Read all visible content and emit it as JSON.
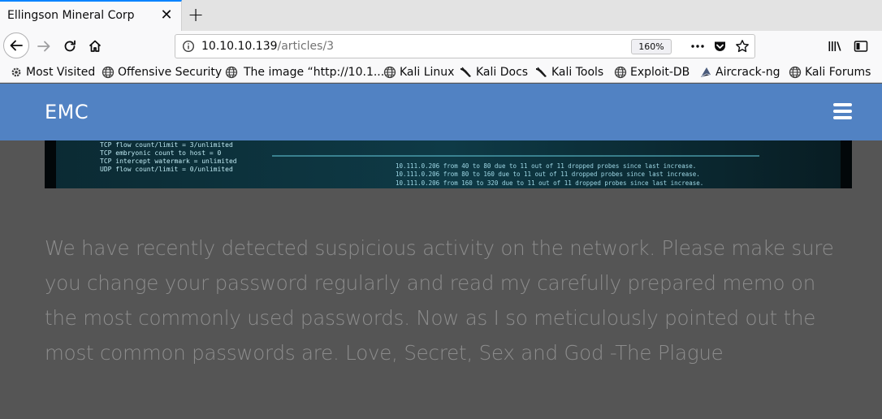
{
  "browser": {
    "tab": {
      "title": "Ellingson Mineral Corp",
      "close": "✕"
    },
    "new_tab": "+",
    "url": {
      "host": "10.10.10.139",
      "path": "/articles/3",
      "zoom": "160%"
    },
    "bookmarks": [
      {
        "label": "Most Visited",
        "icon": "gear-icon"
      },
      {
        "label": "Offensive Security",
        "icon": "globe-icon"
      },
      {
        "label": "The image “http://10.1...",
        "icon": "globe-icon"
      },
      {
        "label": "Kali Linux",
        "icon": "globe-icon"
      },
      {
        "label": "Kali Docs",
        "icon": "kali-dragon-icon"
      },
      {
        "label": "Kali Tools",
        "icon": "kali-dragon-icon"
      },
      {
        "label": "Exploit-DB",
        "icon": "globe-icon"
      },
      {
        "label": "Aircrack-ng",
        "icon": "aircrack-icon"
      },
      {
        "label": "Kali Forums",
        "icon": "globe-icon"
      }
    ]
  },
  "site": {
    "brand": "EMC",
    "banner_lines": [
      "TCP flow count/limit = 3/unlimited",
      "TCP embryonic count to host = 0",
      "TCP intercept watermark = unlimited",
      "UDP flow count/limit = 0/unlimited",
      "10.111.0.206 from 40 to 80 due to 11 out of 11 dropped probes since last increase.",
      "10.111.0.206 from 80 to 160 due to 11 out of 11 dropped probes since last increase.",
      "10.111.0.206 from 160 to 320 due to 11 out of 11 dropped probes since last increase."
    ],
    "article_text": "We have recently detected suspicious activity on the network. Please make sure you change your password regularly and read my carefully prepared memo on the most commonly used passwords. Now as I so meticulously pointed out the most common passwords are. Love, Secret, Sex and God -The Plague"
  },
  "colors": {
    "navbar": "#5182c3",
    "page_background": "#555555",
    "article_text": "#8c8c8c",
    "tab_accent": "#0a84ff"
  }
}
